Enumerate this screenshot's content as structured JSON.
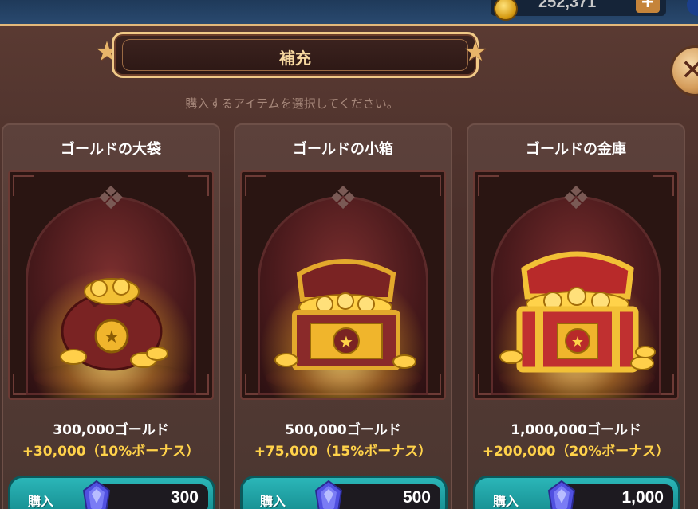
{
  "hud": {
    "gold_amount": "252,371",
    "plus_label": "+"
  },
  "dialog": {
    "title": "補充",
    "subtitle": "購入するアイテムを選択してください。",
    "close_icon": "close-icon"
  },
  "products": [
    {
      "name": "ゴールドの大袋",
      "amount": "300,000ゴールド",
      "bonus": "+30,000（10%ボーナス）",
      "buy_label": "購入",
      "price": "300",
      "icon": "gold-bag-icon"
    },
    {
      "name": "ゴールドの小箱",
      "amount": "500,000ゴールド",
      "bonus": "+75,000（15%ボーナス）",
      "buy_label": "購入",
      "price": "500",
      "icon": "gold-small-chest-icon"
    },
    {
      "name": "ゴールドの金庫",
      "amount": "1,000,000ゴールド",
      "bonus": "+200,000（20%ボーナス）",
      "buy_label": "購入",
      "price": "1,000",
      "icon": "gold-vault-chest-icon"
    }
  ],
  "colors": {
    "panel_bg": "#4a302b",
    "title_text": "#f6d8a0",
    "bonus_text": "#ffd24a",
    "buy_button": "#1fa3a6",
    "gem": "#5a5ae6"
  }
}
